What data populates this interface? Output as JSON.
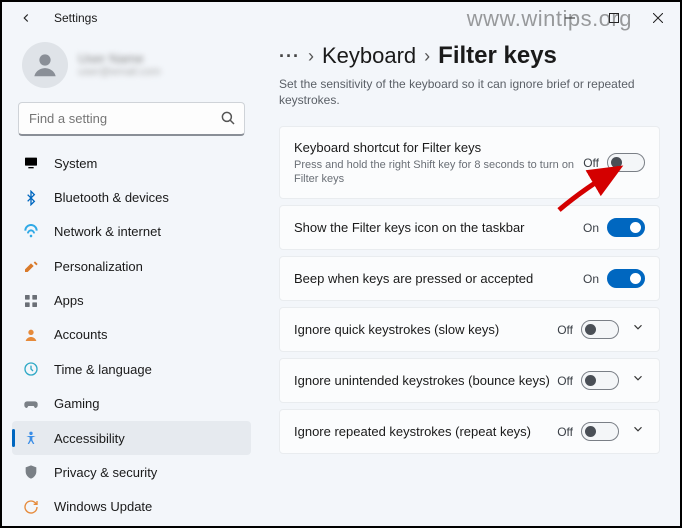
{
  "window": {
    "title": "Settings",
    "watermark": "www.wintips.org"
  },
  "user": {
    "name": "User Name",
    "email": "user@email.com"
  },
  "search": {
    "placeholder": "Find a setting"
  },
  "sidebar": {
    "items": [
      {
        "label": "System"
      },
      {
        "label": "Bluetooth & devices"
      },
      {
        "label": "Network & internet"
      },
      {
        "label": "Personalization"
      },
      {
        "label": "Apps"
      },
      {
        "label": "Accounts"
      },
      {
        "label": "Time & language"
      },
      {
        "label": "Gaming"
      },
      {
        "label": "Accessibility"
      },
      {
        "label": "Privacy & security"
      },
      {
        "label": "Windows Update"
      }
    ]
  },
  "breadcrumb": {
    "ellipsis": "···",
    "parent": "Keyboard",
    "current": "Filter keys"
  },
  "description": "Set the sensitivity of the keyboard so it can ignore brief or repeated keystrokes.",
  "settings": [
    {
      "title": "Keyboard shortcut for Filter keys",
      "sub": "Press and hold the right Shift key for 8 seconds to turn on Filter keys",
      "state": "Off",
      "on": false,
      "expandable": false
    },
    {
      "title": "Show the Filter keys icon on the taskbar",
      "sub": "",
      "state": "On",
      "on": true,
      "expandable": false
    },
    {
      "title": "Beep when keys are pressed or accepted",
      "sub": "",
      "state": "On",
      "on": true,
      "expandable": false
    },
    {
      "title": "Ignore quick keystrokes (slow keys)",
      "sub": "",
      "state": "Off",
      "on": false,
      "expandable": true
    },
    {
      "title": "Ignore unintended keystrokes (bounce keys)",
      "sub": "",
      "state": "Off",
      "on": false,
      "expandable": true
    },
    {
      "title": "Ignore repeated keystrokes (repeat keys)",
      "sub": "",
      "state": "Off",
      "on": false,
      "expandable": true
    }
  ]
}
